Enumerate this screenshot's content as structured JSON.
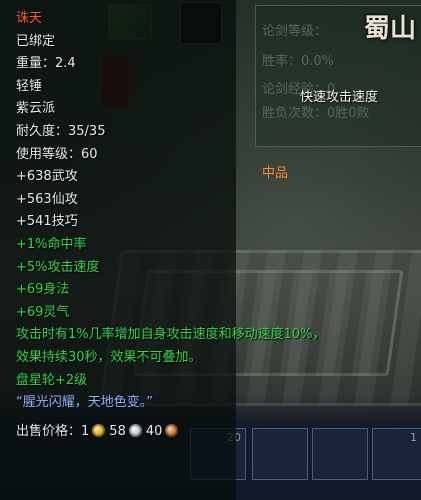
{
  "item": {
    "name": "诛天",
    "bind_status": "已绑定",
    "weight": "重量：2.4",
    "weapon_type": "轻锤",
    "sect": "紫云派",
    "durability": "耐久度：35/35",
    "required_level": "使用等级：60",
    "stats": [
      "+638武攻",
      "+563仙攻",
      "+541技巧"
    ],
    "green_stats": [
      "+1%命中率",
      "+5%攻击速度",
      "+69身法",
      "+69灵气"
    ],
    "effect_line1": "攻击时有1%几率增加自身攻击速度和移动速度10%，",
    "effect_line2": "效果持续30秒，效果不可叠加。",
    "enchant": "盘星轮+2级",
    "quote": "“腥光闪耀，天地色变。”",
    "price_label": "出售价格：",
    "price_gold": "1",
    "price_silver": "58",
    "price_copper": "40"
  },
  "background": {
    "panel_lines": [
      "论剑等级：",
      "胜率：0.0%",
      "论剑经验：0",
      "胜负次数：0胜0败"
    ],
    "action_text": "快速攻击速度",
    "quality_text": "中品",
    "logo_text": "蜀山",
    "slot_counts": [
      "20",
      "",
      "",
      "1"
    ]
  },
  "colors": {
    "item_name": "#ff5a2a",
    "normal_text": "#e8e8e8",
    "bonus_text": "#34d34a",
    "quote_text": "#8fb3ff",
    "quality_text": "#ff8a2a"
  },
  "icons": [
    "gold-coin-icon",
    "silver-coin-icon",
    "copper-coin-icon"
  ]
}
